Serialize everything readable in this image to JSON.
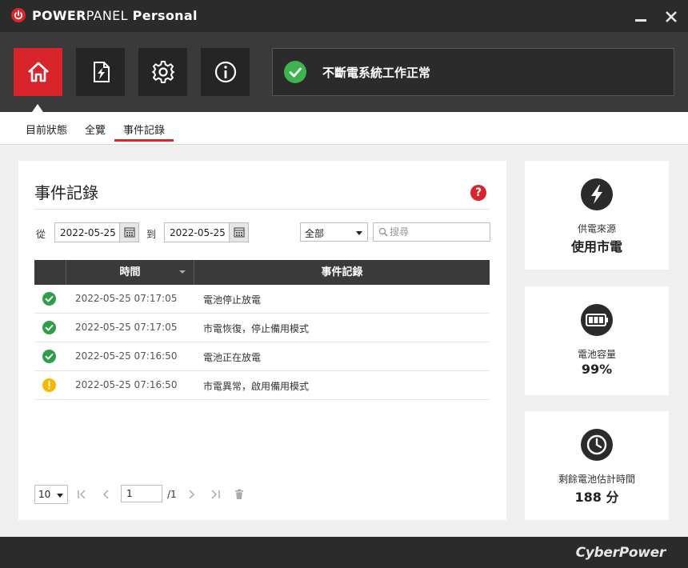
{
  "window": {
    "title_bold": "POWER",
    "title_thin": "PANEL",
    "title_product": " Personal"
  },
  "nav": {
    "items": [
      {
        "id": "home",
        "icon": "home-icon",
        "active": true
      },
      {
        "id": "report",
        "icon": "power-report-icon",
        "active": false
      },
      {
        "id": "settings",
        "icon": "gear-icon",
        "active": false
      },
      {
        "id": "info",
        "icon": "info-icon",
        "active": false
      }
    ]
  },
  "status": {
    "text": "不斷電系統工作正常",
    "color": "#3fb34f"
  },
  "tabs": [
    {
      "label": "目前狀態",
      "active": false
    },
    {
      "label": "全覽",
      "active": false
    },
    {
      "label": "事件記錄",
      "active": true
    }
  ],
  "log": {
    "title": "事件記錄",
    "help": "?",
    "from_label": "從",
    "from_date": "2022-05-25",
    "to_label": "到",
    "to_date": "2022-05-25",
    "filter_selected": "全部",
    "search_placeholder": "搜尋",
    "columns": {
      "time": "時間",
      "event": "事件記錄"
    },
    "rows": [
      {
        "status": "ok",
        "time": "2022-05-25 07:17:05",
        "event": "電池停止放電"
      },
      {
        "status": "ok",
        "time": "2022-05-25 07:17:05",
        "event": "市電恢復，停止備用模式"
      },
      {
        "status": "ok",
        "time": "2022-05-25 07:16:50",
        "event": "電池正在放電"
      },
      {
        "status": "warn",
        "time": "2022-05-25 07:16:50",
        "event": "市電異常，啟用備用模式"
      }
    ],
    "pager": {
      "page_size": "10",
      "current_page": "1",
      "total_pages": "/1"
    }
  },
  "cards": [
    {
      "icon": "lightning-icon",
      "label": "供電來源",
      "value": "使用市電"
    },
    {
      "icon": "battery-icon",
      "label": "電池容量",
      "value": "99%"
    },
    {
      "icon": "clock-icon",
      "label": "剩餘電池估計時間",
      "value": "188 分"
    }
  ],
  "footer": {
    "brand": "CyberPower"
  },
  "colors": {
    "accent": "#d9242c",
    "ok": "#2e9e4a",
    "warn": "#f5b800"
  }
}
